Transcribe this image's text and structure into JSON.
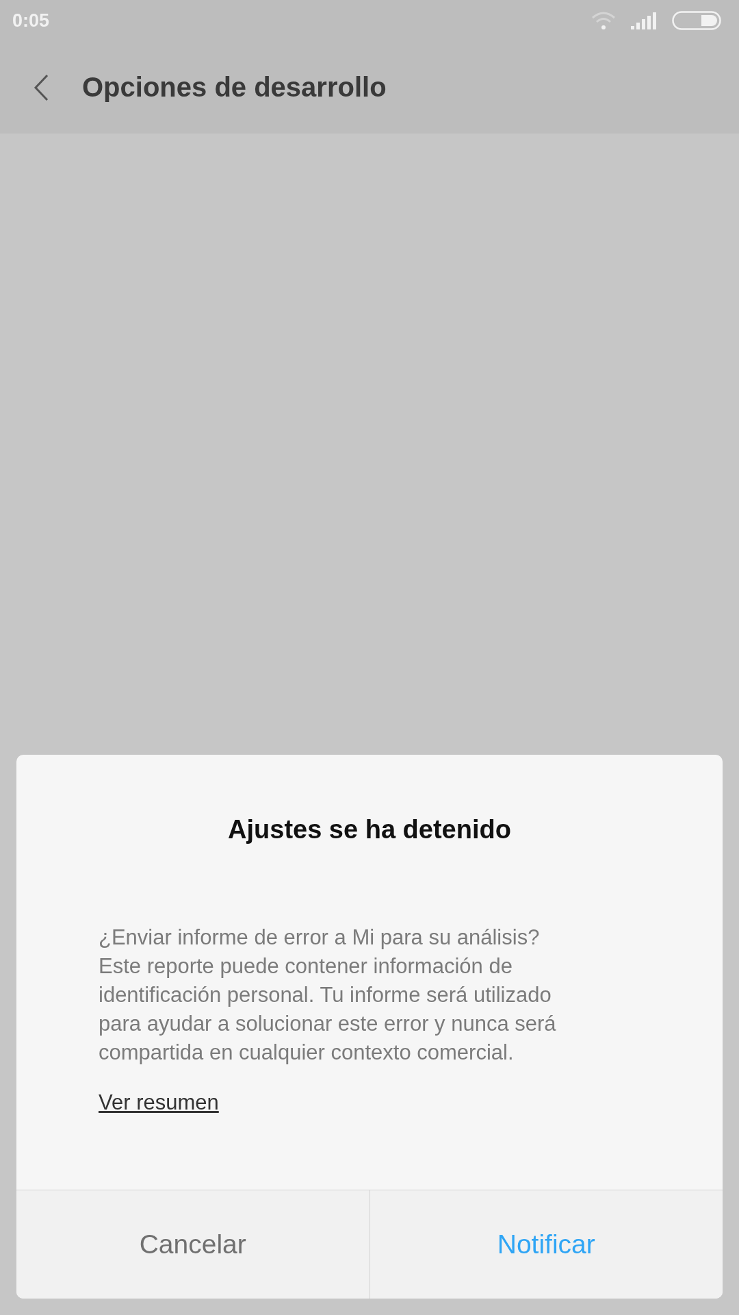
{
  "status_bar": {
    "time": "0:05"
  },
  "header": {
    "title": "Opciones de desarrollo"
  },
  "dialog": {
    "title": "Ajustes se ha detenido",
    "message_lines": [
      "¿Enviar informe de error a Mi para su análisis?",
      "Este reporte puede contener información de",
      "identificación personal. Tu informe será utilizado",
      "para ayudar a solucionar este error y nunca será",
      "compartida en cualquier contexto comercial."
    ],
    "link": "Ver resumen",
    "buttons": [
      {
        "label": "Cancelar",
        "kind": "neutral"
      },
      {
        "label": "Notificar",
        "kind": "accent"
      }
    ]
  }
}
